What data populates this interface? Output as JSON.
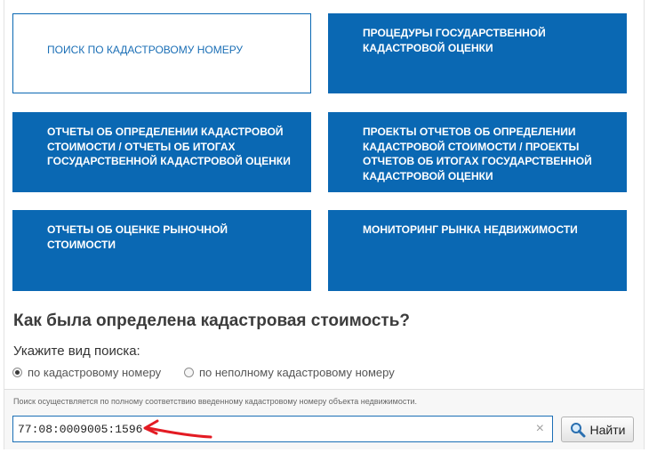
{
  "tiles": [
    {
      "label": "ПОИСК ПО КАДАСТРОВОМУ НОМЕРУ"
    },
    {
      "label": "ПРОЦЕДУРЫ ГОСУДАРСТВЕННОЙ КАДАСТРОВОЙ ОЦЕНКИ"
    },
    {
      "label": "ОТЧЕТЫ ОБ ОПРЕДЕЛЕНИИ КАДАСТРОВОЙ СТОИМОСТИ / ОТЧЕТЫ ОБ ИТОГАХ ГОСУДАРСТВЕННОЙ КАДАСТРОВОЙ ОЦЕНКИ"
    },
    {
      "label": "ПРОЕКТЫ ОТЧЕТОВ ОБ ОПРЕДЕЛЕНИИ КАДАСТРОВОЙ СТОИМОСТИ / ПРОЕКТЫ ОТЧЕТОВ ОБ ИТОГАХ ГОСУДАРСТВЕННОЙ КАДАСТРОВОЙ ОЦЕНКИ"
    },
    {
      "label": "ОТЧЕТЫ ОБ ОЦЕНКЕ РЫНОЧНОЙ СТОИМОСТИ"
    },
    {
      "label": "МОНИТОРИНГ РЫНКА НЕДВИЖИМОСТИ"
    }
  ],
  "section": {
    "heading": "Как была определена кадастровая стоимость?",
    "search_type_label": "Укажите вид поиска:",
    "options": [
      {
        "label": "по кадастровому номеру",
        "selected": true
      },
      {
        "label": "по неполному кадастровому номеру",
        "selected": false
      }
    ]
  },
  "search": {
    "info": "Поиск осуществляется по полному соответствию введенному кадастровому номеру объекта недвижимости.",
    "value": "77:08:0009005:1596",
    "clear_icon": "×",
    "button_label": "Найти",
    "button_icon": "magnifier-icon"
  },
  "colors": {
    "tile_blue": "#0a68b3",
    "active_text": "#1b6fb6",
    "annotation_red": "#e31b23"
  }
}
